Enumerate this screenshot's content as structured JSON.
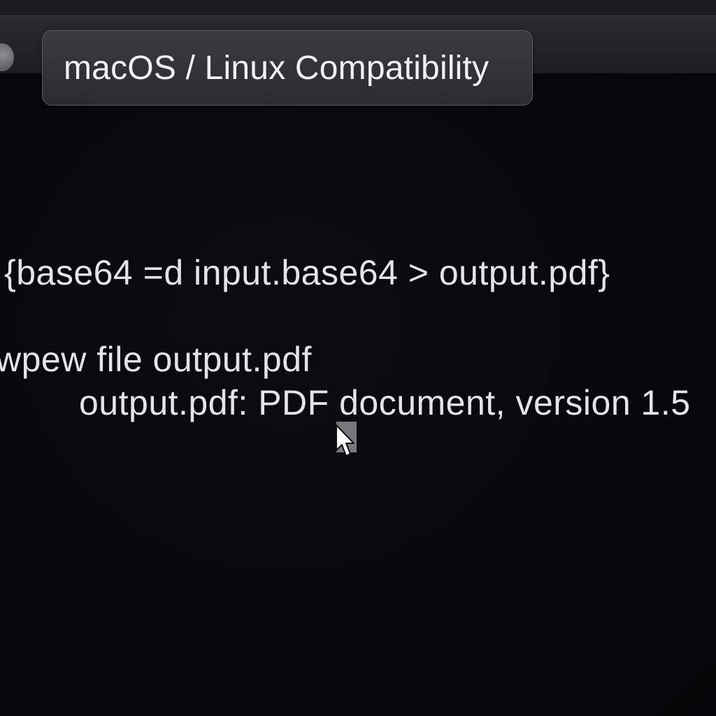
{
  "tab": {
    "title": "macOS / Linux Compatibility"
  },
  "terminal": {
    "lines": [
      "{base64 =d input.base64 > output.pdf}",
      "wpew file output.pdf",
      "output.pdf: PDF document, version 1.5"
    ]
  },
  "icons": {
    "window_control": "window-control-button",
    "pointer": "mouse-pointer-icon"
  },
  "colors": {
    "background": "#06070b",
    "titlebar": "#242529",
    "tab": "#333438",
    "text": "#e2e4e8"
  }
}
